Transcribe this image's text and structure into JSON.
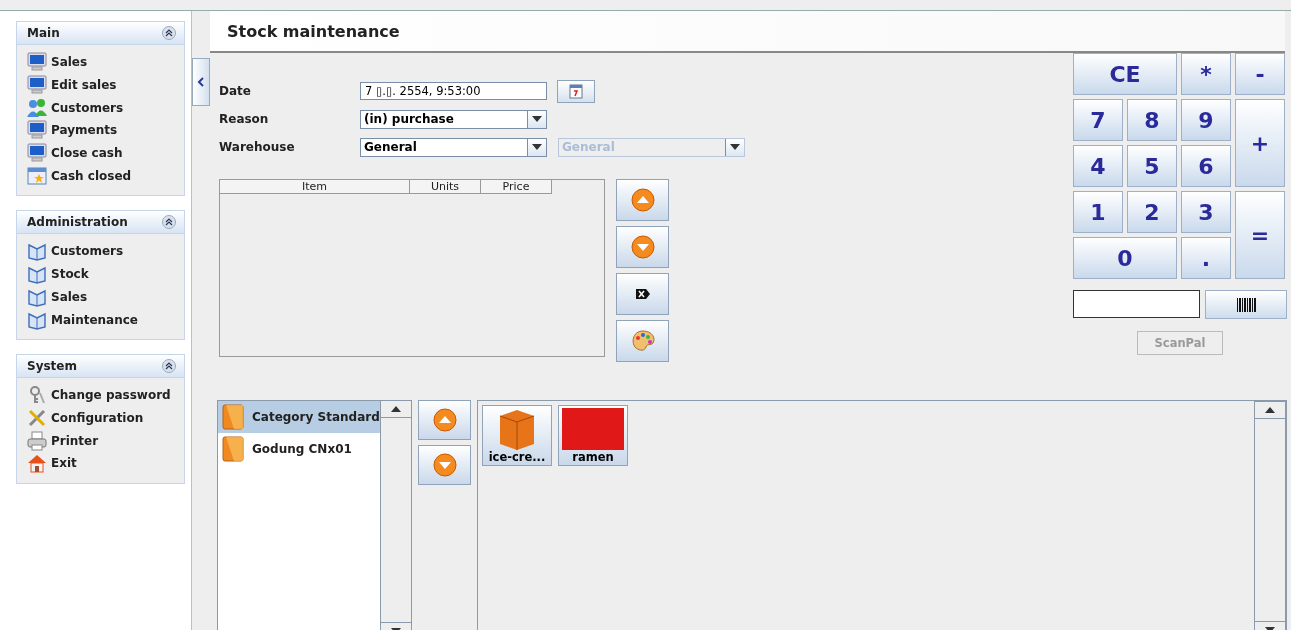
{
  "sidebar": {
    "panels": [
      {
        "title": "Main",
        "items": [
          {
            "label": "Sales",
            "kind": "monitor"
          },
          {
            "label": "Edit sales",
            "kind": "monitor"
          },
          {
            "label": "Customers",
            "kind": "people"
          },
          {
            "label": "Payments",
            "kind": "monitor"
          },
          {
            "label": "Close cash",
            "kind": "monitor"
          },
          {
            "label": "Cash closed",
            "kind": "calendar"
          }
        ]
      },
      {
        "title": "Administration",
        "items": [
          {
            "label": "Customers",
            "kind": "book"
          },
          {
            "label": "Stock",
            "kind": "book"
          },
          {
            "label": "Sales",
            "kind": "book"
          },
          {
            "label": "Maintenance",
            "kind": "book"
          }
        ]
      },
      {
        "title": "System",
        "items": [
          {
            "label": "Change password",
            "kind": "keys"
          },
          {
            "label": "Configuration",
            "kind": "tools"
          },
          {
            "label": "Printer",
            "kind": "printer"
          },
          {
            "label": "Exit",
            "kind": "house"
          }
        ]
      }
    ]
  },
  "title": "Stock maintenance",
  "form": {
    "date": {
      "label": "Date",
      "value": "7 ▯.▯. 2554, 9:53:00"
    },
    "reason": {
      "label": "Reason",
      "value": "(in) purchase"
    },
    "warehouse": {
      "label": "Warehouse",
      "value": "General",
      "second": {
        "value": "General",
        "disabled": true
      }
    }
  },
  "table": {
    "columns": [
      "Item",
      "Units",
      "Price"
    ]
  },
  "keypad": {
    "keys": [
      "CE",
      "*",
      "-",
      "7",
      "8",
      "9",
      "+",
      "4",
      "5",
      "6",
      "1",
      "2",
      "3",
      "=",
      "0",
      "."
    ],
    "scan_button": {
      "label": "ScanPal",
      "disabled": true
    }
  },
  "categories": [
    {
      "label": "Category Standard",
      "selected": true
    },
    {
      "label": "Godung CNx01",
      "selected": false
    }
  ],
  "products": [
    {
      "label": "ice-cre...",
      "kind": "box"
    },
    {
      "label": "ramen",
      "kind": "photo"
    }
  ]
}
